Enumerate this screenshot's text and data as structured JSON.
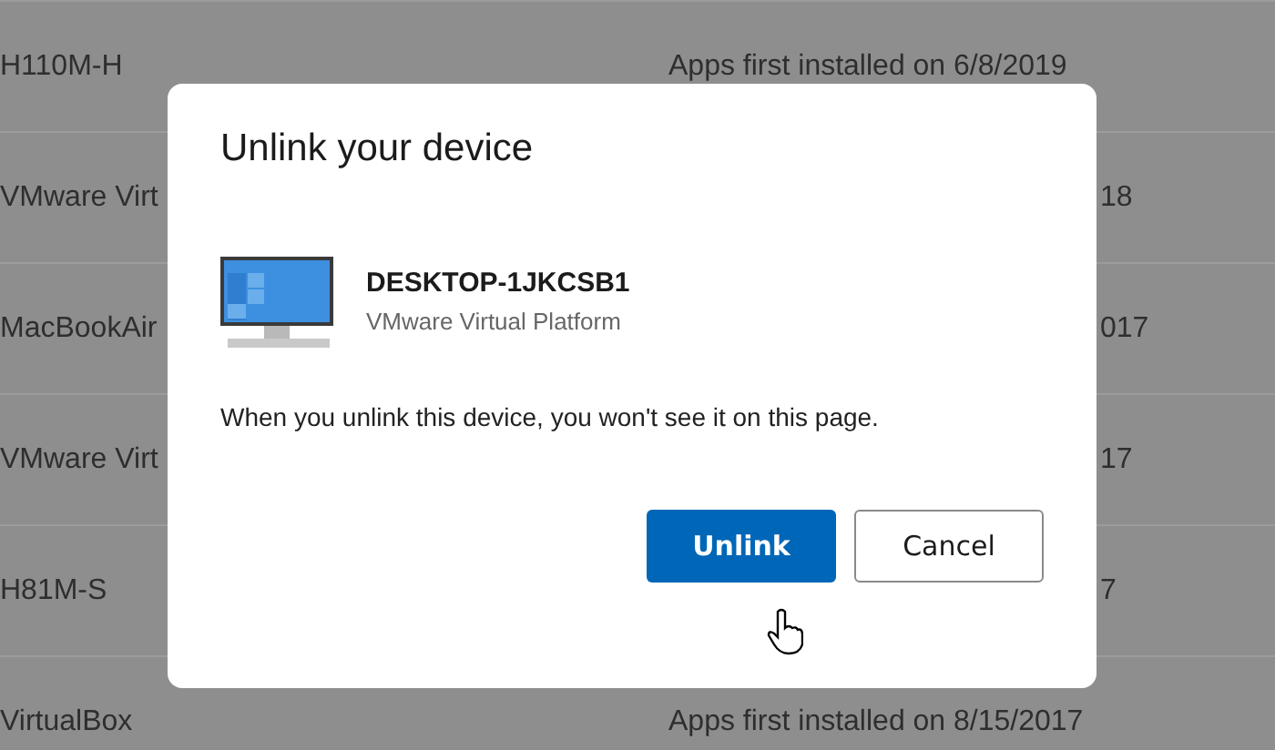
{
  "devices": [
    {
      "name": "H110M-H",
      "installed": "Apps first installed on 6/8/2019",
      "covered": false
    },
    {
      "name": "VMware Virt",
      "installed": "18",
      "covered": true
    },
    {
      "name": "MacBookAir",
      "installed": "017",
      "covered": true
    },
    {
      "name": "VMware Virt",
      "installed": "17",
      "covered": true
    },
    {
      "name": "H81M-S",
      "installed": "7",
      "covered": true
    },
    {
      "name": "VirtualBox",
      "installed": "Apps first installed on 8/15/2017",
      "covered": false
    }
  ],
  "dialog": {
    "title": "Unlink your device",
    "device_name": "DESKTOP-1JKCSB1",
    "device_model": "VMware Virtual Platform",
    "message": "When you unlink this device, you won't see it on this page.",
    "buttons": [
      {
        "label": "Unlink",
        "kind": "primary"
      },
      {
        "label": "Cancel",
        "kind": "secondary"
      }
    ]
  }
}
